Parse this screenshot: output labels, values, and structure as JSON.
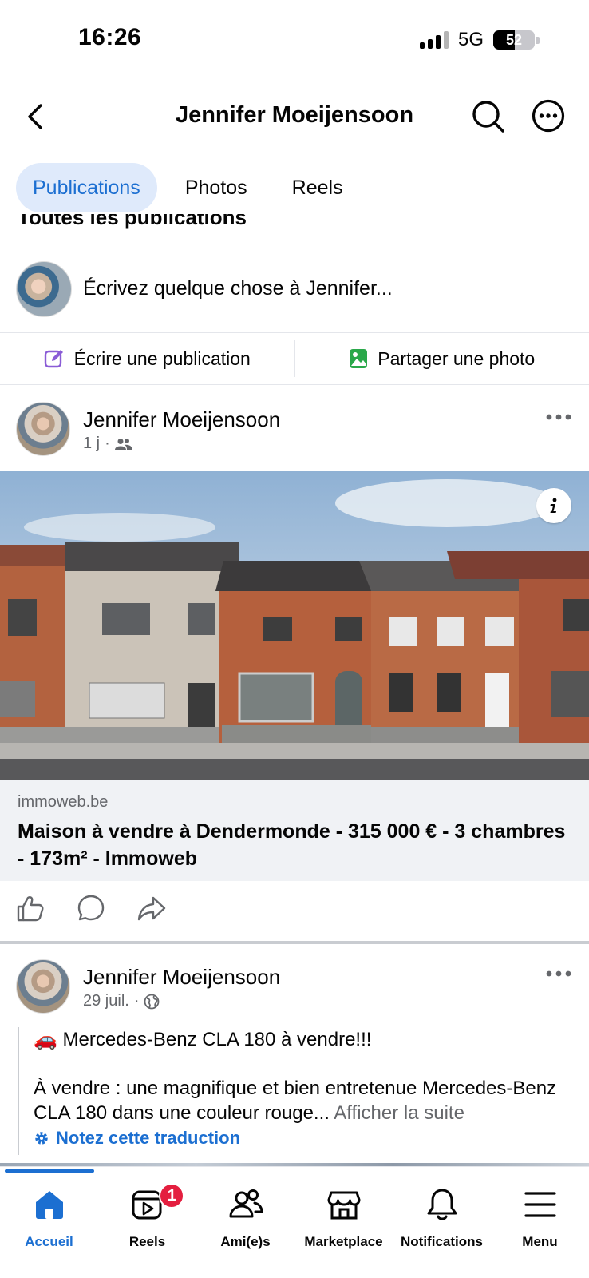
{
  "status_bar": {
    "time": "16:26",
    "network": "5G",
    "battery": "52",
    "battery_level": 0.52
  },
  "header": {
    "title": "Jennifer Moeijensoon"
  },
  "tabs": [
    {
      "label": "Publications",
      "active": true
    },
    {
      "label": "Photos",
      "active": false
    },
    {
      "label": "Reels",
      "active": false
    }
  ],
  "section_title": "Toutes les publications",
  "composer": {
    "placeholder": "Écrivez quelque chose à Jennifer...",
    "write_label": "Écrire une publication",
    "photo_label": "Partager une photo"
  },
  "post1": {
    "author": "Jennifer Moeijensoon",
    "time": "1 j",
    "audience_icon": "friends-icon",
    "link_domain": "immoweb.be",
    "link_title": "Maison à vendre à Dendermonde - 315 000 € - 3 chambres - 173m² - Immoweb"
  },
  "post2": {
    "author": "Jennifer Moeijensoon",
    "time": "29 juil.",
    "audience_icon": "globe-icon",
    "line1": "🚗 Mercedes-Benz CLA 180 à vendre!!!",
    "line2": "À vendre : une magnifique et bien entretenue Mercedes-Benz CLA 180 dans une couleur rouge...",
    "see_more": "Afficher la suite",
    "translate": "Notez cette traduction"
  },
  "nav": [
    {
      "label": "Accueil",
      "icon": "home-icon",
      "active": true
    },
    {
      "label": "Reels",
      "icon": "reels-icon",
      "badge": "1"
    },
    {
      "label": "Ami(e)s",
      "icon": "friends-icon"
    },
    {
      "label": "Marketplace",
      "icon": "marketplace-icon"
    },
    {
      "label": "Notifications",
      "icon": "bell-icon"
    },
    {
      "label": "Menu",
      "icon": "menu-icon"
    }
  ],
  "colors": {
    "accent": "#1c6fd1",
    "badge": "#e41e3f",
    "muted": "#65676b"
  }
}
